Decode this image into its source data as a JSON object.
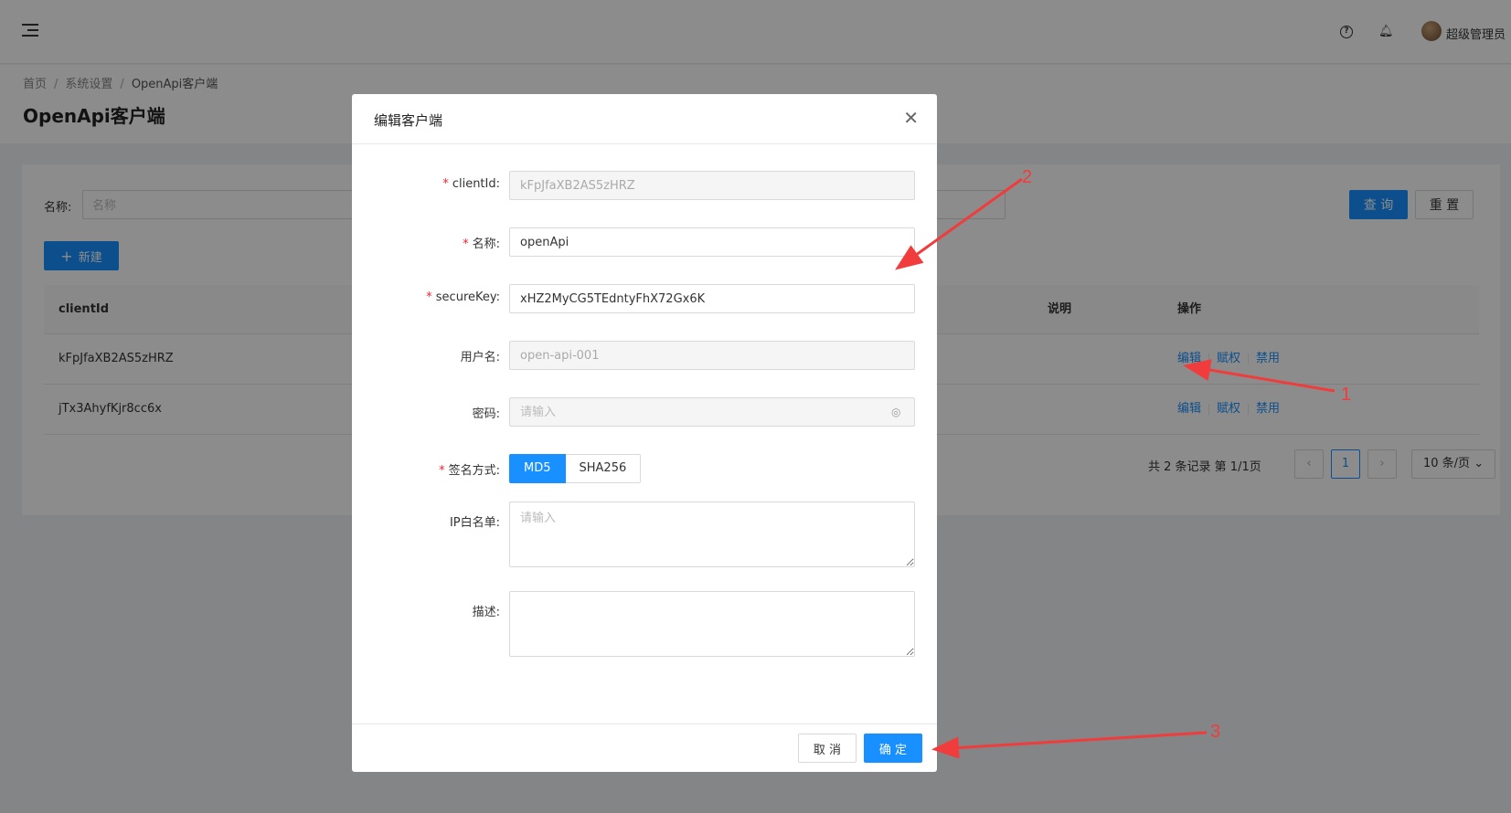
{
  "header": {
    "user_name": "超级管理员"
  },
  "breadcrumb": [
    "首页",
    "系统设置",
    "OpenApi客户端"
  ],
  "page_title": "OpenApi客户端",
  "filter": {
    "label": "名称:",
    "placeholder": "名称",
    "query_label": "查 询",
    "reset_label": "重 置"
  },
  "new_button": "新建",
  "table": {
    "columns": [
      "clientId",
      "说明",
      "操作"
    ],
    "rows": [
      {
        "client_id": "kFpJfaXB2AS5zHRZ",
        "actions": [
          "编辑",
          "赋权",
          "禁用"
        ]
      },
      {
        "client_id": "jTx3AhyfKjr8cc6x",
        "actions": [
          "编辑",
          "赋权",
          "禁用"
        ]
      }
    ]
  },
  "pagination": {
    "total_text": "共 2 条记录 第 1/1页",
    "current_page": "1",
    "page_size": "10 条/页"
  },
  "modal": {
    "title": "编辑客户端",
    "fields": {
      "client_id": {
        "label": "clientId:",
        "value": "kFpJfaXB2AS5zHRZ"
      },
      "name": {
        "label": "名称:",
        "value": "openApi"
      },
      "secure_key": {
        "label": "secureKey:",
        "value": "xHZ2MyCG5TEdntyFhX72Gx6K"
      },
      "username": {
        "label": "用户名:",
        "value": "open-api-001"
      },
      "password": {
        "label": "密码:",
        "placeholder": "请输入"
      },
      "sign_method": {
        "label": "签名方式:",
        "options": [
          "MD5",
          "SHA256"
        ],
        "selected": "MD5"
      },
      "ip_whitelist": {
        "label": "IP白名单:",
        "placeholder": "请输入"
      },
      "description": {
        "label": "描述:"
      }
    },
    "cancel_label": "取 消",
    "ok_label": "确 定"
  },
  "annotations": [
    "1",
    "2",
    "3"
  ],
  "colors": {
    "primary": "#1890ff",
    "required": "#f5222d",
    "annotation": "#f03c3c"
  }
}
